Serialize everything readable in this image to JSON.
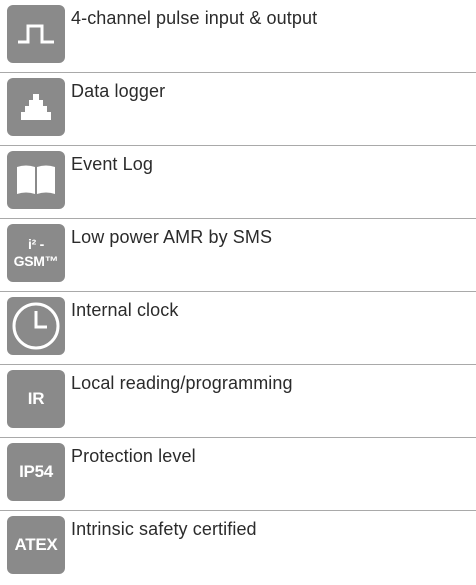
{
  "features": [
    {
      "id": "pulse",
      "icon": "pulse-wave-icon",
      "label": "4-channel pulse input & output"
    },
    {
      "id": "logger",
      "icon": "data-logger-icon",
      "label": "Data logger"
    },
    {
      "id": "eventlog",
      "icon": "open-book-icon",
      "label": "Event Log"
    },
    {
      "id": "gsm",
      "icon": "gsm-text-icon",
      "icon_line1": "i² -",
      "icon_line2": "GSM™",
      "label": "Low power AMR by SMS"
    },
    {
      "id": "clock",
      "icon": "clock-icon",
      "label": "Internal clock"
    },
    {
      "id": "ir",
      "icon": "ir-text-icon",
      "icon_text": "IR",
      "label": "Local reading/programming"
    },
    {
      "id": "ip54",
      "icon": "ip54-text-icon",
      "icon_text": "IP54",
      "label": "Protection level"
    },
    {
      "id": "atex",
      "icon": "atex-text-icon",
      "icon_text": "ATEX",
      "label": "Intrinsic safety certified"
    }
  ]
}
